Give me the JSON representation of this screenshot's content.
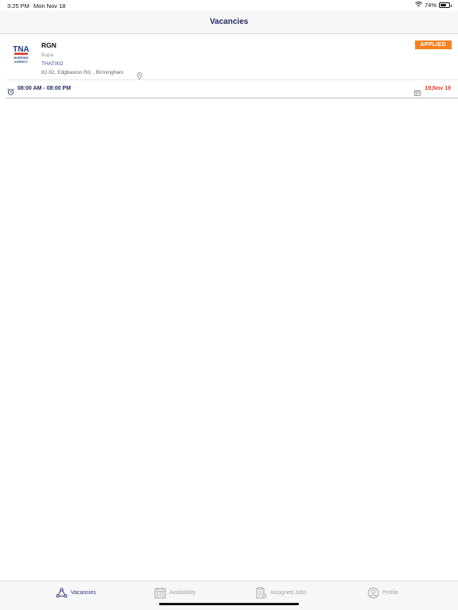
{
  "status_bar": {
    "time": "3:25 PM",
    "date": "Mon Nov 18",
    "battery_percent": "74%",
    "battery_level": 0.74,
    "icons": [
      "wifi-icon",
      "battery-icon"
    ]
  },
  "header": {
    "title": "Vacancies"
  },
  "vacancies": [
    {
      "logo": {
        "initials": "TNA",
        "line1": "NURSING",
        "line2": "AGENCY"
      },
      "title": "RGN",
      "company": "Bupa",
      "code": "THAT002",
      "address": "82-92, Edgbaston Rd, , Birmingham",
      "status": "APPLIED",
      "time_range": "08:00 AM - 08:00 PM",
      "date": "19,Nov 19"
    }
  ],
  "tab_bar": {
    "tabs": [
      {
        "label": "Vacancies",
        "icon": "vacancies-icon",
        "active": true
      },
      {
        "label": "Availability",
        "icon": "calendar-icon",
        "active": false
      },
      {
        "label": "Assigned Jobs",
        "icon": "clipboard-icon",
        "active": false
      },
      {
        "label": "Profile",
        "icon": "profile-icon",
        "active": false
      }
    ]
  },
  "colors": {
    "accent_navy": "#1f2a5e",
    "badge_orange": "#f5821f",
    "date_red": "#e03a2c",
    "tab_inactive": "#a3a3a8"
  }
}
